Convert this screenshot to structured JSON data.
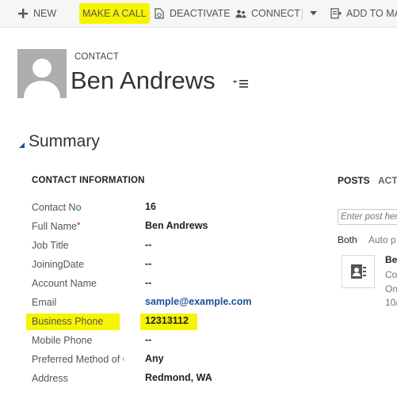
{
  "toolbar": {
    "new_label": "NEW",
    "call_label": "MAKE A CALL",
    "deactivate_label": "DEACTIVATE",
    "connect_label": "CONNECT",
    "add_label": "ADD TO MA"
  },
  "header": {
    "entity_type": "CONTACT",
    "record_name": "Ben Andrews"
  },
  "section": {
    "title": "Summary",
    "group_title": "CONTACT INFORMATION",
    "fields": [
      {
        "label": "Contact No",
        "value": "16"
      },
      {
        "label": "Full Name",
        "value": "Ben Andrews",
        "required": "*"
      },
      {
        "label": "Job Title",
        "value": "--"
      },
      {
        "label": "JoiningDate",
        "value": "--"
      },
      {
        "label": "Account Name",
        "value": "--"
      },
      {
        "label": "Email",
        "value": "sample@example.com"
      },
      {
        "label": "Business Phone",
        "value": "12313112"
      },
      {
        "label": "Mobile Phone",
        "value": "--"
      },
      {
        "label": "Preferred Method of C",
        "value": "Any"
      },
      {
        "label": "Address",
        "value": "Redmond, WA"
      }
    ]
  },
  "social": {
    "tab_posts": "POSTS",
    "tab_activities": "ACTI",
    "post_placeholder": "Enter post her",
    "filter_both": "Both",
    "filter_auto": "Auto p",
    "post_line1": "Be",
    "post_line2": "Co",
    "post_line3": "On",
    "post_line4": "10/"
  },
  "colors": {
    "highlight": "#f7f400",
    "link": "#1f4e9c",
    "required": "#cc0000"
  }
}
